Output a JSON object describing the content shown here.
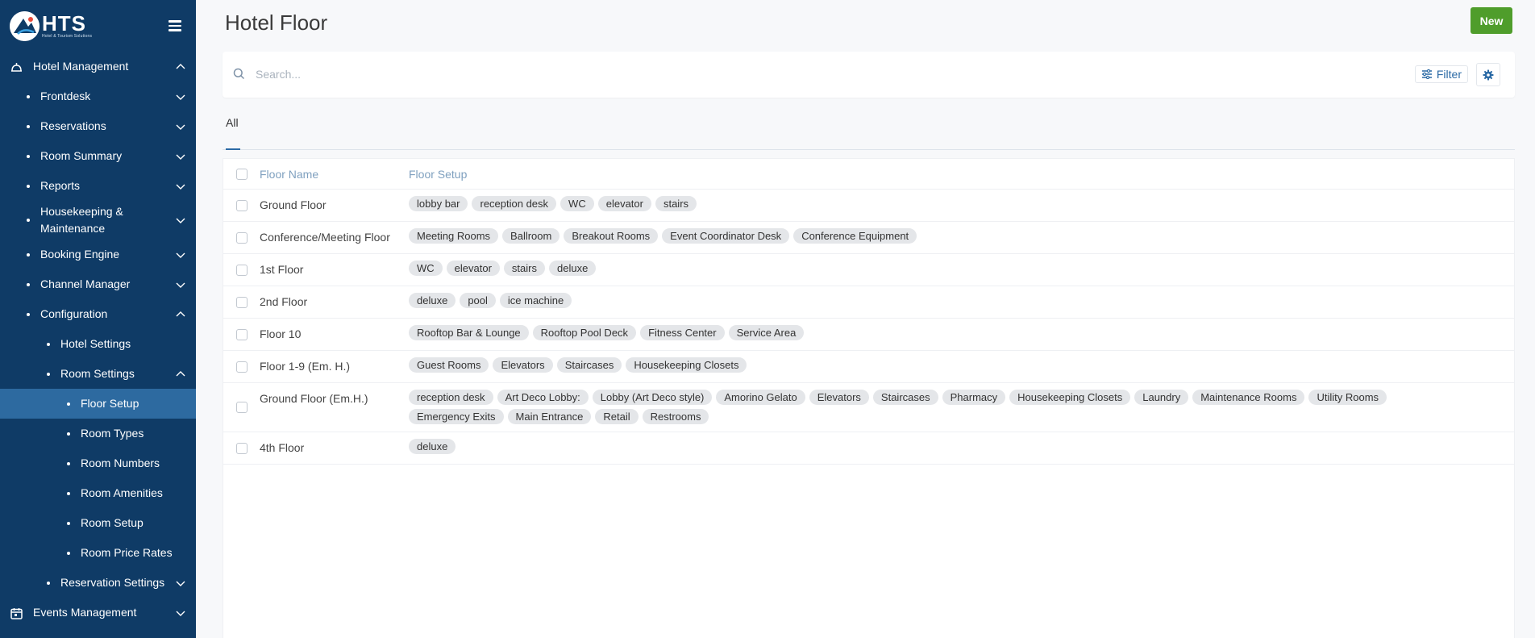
{
  "logo": {
    "main": "HTS",
    "sub": "Hotel & Tourism Solutions"
  },
  "sidebar": {
    "hotel_management": "Hotel Management",
    "frontdesk": "Frontdesk",
    "reservations": "Reservations",
    "room_summary": "Room Summary",
    "reports": "Reports",
    "housekeeping_l1": "Housekeeping &",
    "housekeeping_l2": "Maintenance",
    "booking_engine": "Booking Engine",
    "channel_manager": "Channel Manager",
    "configuration": "Configuration",
    "hotel_settings": "Hotel Settings",
    "room_settings": "Room Settings",
    "floor_setup": "Floor Setup",
    "room_types": "Room Types",
    "room_numbers": "Room Numbers",
    "room_amenities": "Room Amenities",
    "room_setup": "Room Setup",
    "room_price_rates": "Room Price Rates",
    "reservation_settings": "Reservation Settings",
    "events_management": "Events Management"
  },
  "page": {
    "title": "Hotel Floor",
    "new_label": "New"
  },
  "search": {
    "placeholder": "Search..."
  },
  "toolbar": {
    "filter_label": "Filter"
  },
  "tabs": {
    "all": "All"
  },
  "table": {
    "headers": {
      "name": "Floor Name",
      "setup": "Floor Setup"
    },
    "rows": [
      {
        "name": "Ground Floor",
        "tags": [
          "lobby bar",
          "reception desk",
          "WC",
          "elevator",
          "stairs"
        ]
      },
      {
        "name": "Conference/Meeting Floor",
        "tags": [
          "Meeting Rooms",
          "Ballroom",
          "Breakout Rooms",
          "Event Coordinator Desk",
          "Conference Equipment"
        ]
      },
      {
        "name": "1st Floor",
        "tags": [
          "WC",
          "elevator",
          "stairs",
          "deluxe"
        ]
      },
      {
        "name": "2nd Floor",
        "tags": [
          "deluxe",
          "pool",
          "ice machine"
        ]
      },
      {
        "name": "Floor 10",
        "tags": [
          "Rooftop Bar & Lounge",
          "Rooftop Pool Deck",
          "Fitness Center",
          "Service Area"
        ]
      },
      {
        "name": "Floor 1-9 (Em. H.)",
        "tags": [
          "Guest Rooms",
          "Elevators",
          "Staircases",
          "Housekeeping Closets"
        ]
      },
      {
        "name": "Ground Floor (Em.H.)",
        "tags": [
          "reception desk",
          "Art Deco Lobby:",
          "Lobby (Art Deco style)",
          "Amorino Gelato",
          "Elevators",
          "Staircases",
          "Pharmacy",
          "Housekeeping Closets",
          "Laundry",
          "Maintenance Rooms",
          "Utility Rooms",
          "Emergency Exits",
          "Main Entrance",
          "Retail",
          "Restrooms"
        ]
      },
      {
        "name": "4th Floor",
        "tags": [
          "deluxe"
        ]
      }
    ]
  },
  "colors": {
    "sidebar_bg": "#0f3b66",
    "active_bg": "#2d6aa0",
    "primary": "#2b6aa5",
    "new_button": "#4f9d2b"
  }
}
